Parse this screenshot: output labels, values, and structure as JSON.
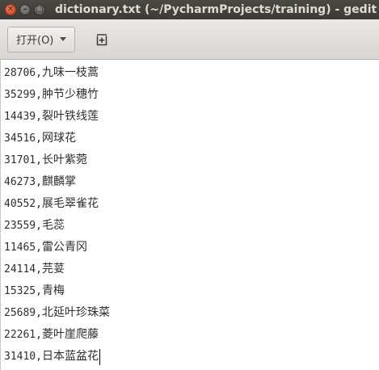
{
  "window": {
    "title": "dictionary.txt (~/PycharmProjects/training) - gedit",
    "close_glyph": "✕",
    "minimize_glyph": "–",
    "maximize_glyph": "□"
  },
  "toolbar": {
    "open_label": "打开(O)",
    "open_icon": "chevron-down-icon",
    "new_document_icon": "new-document-icon"
  },
  "document": {
    "separator": ",",
    "lines": [
      {
        "code": "28706",
        "name": "九味一枝蒿"
      },
      {
        "code": "35299",
        "name": "肿节少穗竹"
      },
      {
        "code": "14439",
        "name": "裂叶铁线莲"
      },
      {
        "code": "34516",
        "name": "网球花"
      },
      {
        "code": "31701",
        "name": "长叶紫菀"
      },
      {
        "code": "46273",
        "name": "麒麟掌"
      },
      {
        "code": "40552",
        "name": "展毛翠雀花"
      },
      {
        "code": "23559",
        "name": "毛蕊"
      },
      {
        "code": "11465",
        "name": "雷公青冈"
      },
      {
        "code": "24114",
        "name": "芫荽"
      },
      {
        "code": "15325",
        "name": "青梅"
      },
      {
        "code": "25689",
        "name": "北延叶珍珠菜"
      },
      {
        "code": "22261",
        "name": "菱叶崖爬藤"
      },
      {
        "code": "31410",
        "name": "日本蓝盆花"
      }
    ]
  }
}
